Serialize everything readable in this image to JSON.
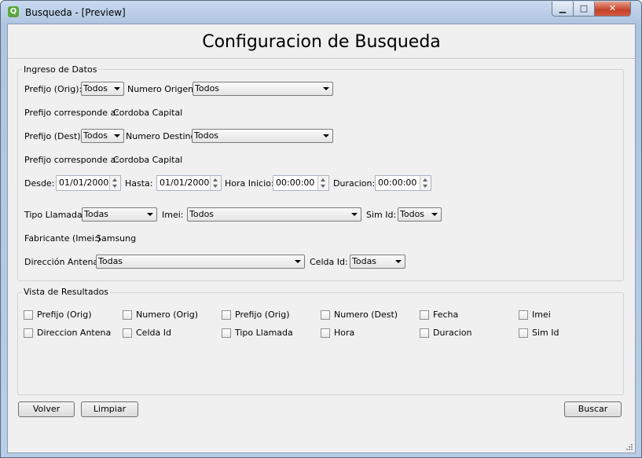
{
  "window": {
    "title": "Busqueda - [Preview]",
    "icon": "app-icon",
    "controls": [
      "minimize-icon",
      "maximize-icon",
      "close-icon"
    ]
  },
  "heading": "Configuracion de Busqueda",
  "ingreso": {
    "title": "Ingreso de Datos",
    "prefijo_orig_label": "Prefijo (Orig):",
    "prefijo_orig_value": "Todos",
    "numero_origen_label": "Numero Origen:",
    "numero_origen_value": "Todos",
    "prefijo_corresponde_label_1": "Prefijo corresponde a:",
    "prefijo_corresponde_value_1": "Cordoba Capital",
    "prefijo_dest_label": "Prefijo (Dest):",
    "prefijo_dest_value": "Todos",
    "numero_destino_label": "Numero Destino:",
    "numero_destino_value": "Todos",
    "prefijo_corresponde_label_2": "Prefijo corresponde a:",
    "prefijo_corresponde_value_2": "Cordoba Capital",
    "desde_label": "Desde:",
    "desde_value": "01/01/2000",
    "hasta_label": "Hasta:",
    "hasta_value": "01/01/2000",
    "hora_inicio_label": "Hora Inicio:",
    "hora_inicio_value": "00:00:00",
    "duracion_label": "Duracion:",
    "duracion_value": "00:00:00",
    "tipo_llamada_label": "Tipo Llamada:",
    "tipo_llamada_value": "Todas",
    "imei_label": "Imei:",
    "imei_value": "Todos",
    "sim_id_label": "Sim Id:",
    "sim_id_value": "Todos",
    "fabricante_label": "Fabricante (Imei:)",
    "fabricante_value": "Samsung",
    "direccion_antena_label": "Dirección Antena:",
    "direccion_antena_value": "Todas",
    "celda_id_label": "Celda Id:",
    "celda_id_value": "Todas"
  },
  "resultados": {
    "title": "Vista de Resultados",
    "checkboxes": [
      "Prefijo (Orig)",
      "Numero (Orig)",
      "Prefijo (Orig)",
      "Numero (Dest)",
      "Fecha",
      "Imei",
      "Direccion Antena",
      "Celda Id",
      "Tipo Llamada",
      "Hora",
      "Duracion",
      "Sim Id"
    ]
  },
  "buttons": {
    "volver": "Volver",
    "limpiar": "Limpiar",
    "buscar": "Buscar"
  }
}
